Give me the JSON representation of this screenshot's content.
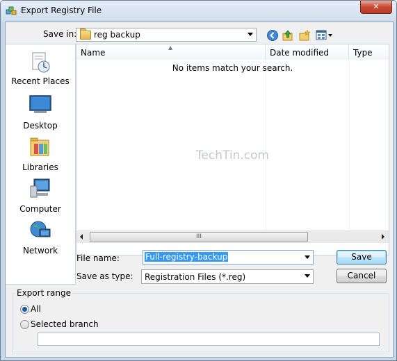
{
  "window": {
    "title": "Export Registry File",
    "close_label": "✕"
  },
  "toolbar": {
    "savein_label": "Save in:",
    "folder_value": "reg backup",
    "icons": [
      "back-icon",
      "up-folder-icon",
      "new-folder-icon",
      "views-menu-icon"
    ]
  },
  "places": [
    {
      "label": "Recent Places",
      "icon": "recent-places-icon"
    },
    {
      "label": "Desktop",
      "icon": "desktop-icon"
    },
    {
      "label": "Libraries",
      "icon": "libraries-icon"
    },
    {
      "label": "Computer",
      "icon": "computer-icon"
    },
    {
      "label": "Network",
      "icon": "network-icon"
    }
  ],
  "filelist": {
    "columns": [
      "Name",
      "Date modified",
      "Type"
    ],
    "empty_message": "No items match your search.",
    "watermark": "TechTin.com",
    "scroll_thumb_grip": "III"
  },
  "form": {
    "filename_label": "File name:",
    "filename_value": "Full-registry-backup",
    "savetype_label": "Save as type:",
    "savetype_value": "Registration Files (*.reg)",
    "save_button": "Save",
    "cancel_button": "Cancel"
  },
  "export_range": {
    "label": "Export range",
    "options": [
      {
        "label": "All",
        "selected": true
      },
      {
        "label": "Selected branch",
        "selected": false
      }
    ],
    "branch_value": ""
  },
  "colors": {
    "accent": "#3399ff",
    "frame": "#c9d9ec"
  }
}
